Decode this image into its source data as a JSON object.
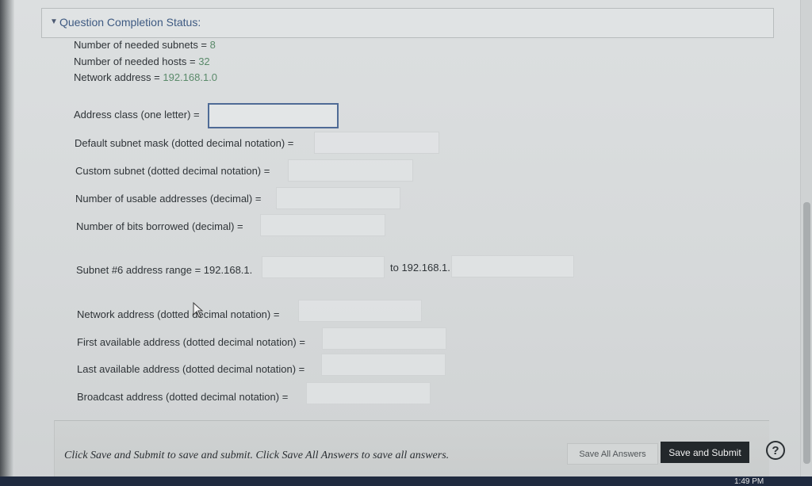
{
  "status": {
    "label": "Question Completion Status:"
  },
  "given": {
    "subnets": {
      "label": "Number of needed subnets = ",
      "value": "8"
    },
    "hosts": {
      "label": "Number of needed hosts = ",
      "value": "32"
    },
    "network": {
      "label": "Network address = ",
      "value": "192.168.1.0"
    }
  },
  "questions": {
    "address_class": {
      "label": "Address class (one letter) =",
      "value": ""
    },
    "default_mask": {
      "label": "Default subnet mask (dotted decimal notation) =",
      "value": ""
    },
    "custom_subnet": {
      "label": "Custom subnet (dotted decimal notation) =",
      "value": ""
    },
    "usable": {
      "label": "Number of usable addresses (decimal) =",
      "value": ""
    },
    "bits_borrowed": {
      "label": "Number of bits borrowed (decimal) =",
      "value": ""
    },
    "subnet6_range": {
      "label": "Subnet #6 address range = 192.168.1.",
      "to_label": "to 192.168.1.",
      "start": "",
      "end": ""
    },
    "net_address": {
      "label": "Network address (dotted decimal notation) =",
      "value": ""
    },
    "first_available": {
      "label": "First available address (dotted decimal notation) =",
      "value": ""
    },
    "last_available": {
      "label": "Last available address (dotted decimal notation) =",
      "value": ""
    },
    "broadcast": {
      "label": "Broadcast address (dotted decimal notation) =",
      "value": ""
    }
  },
  "footer": {
    "instructions": "Click Save and Submit to save and submit. Click Save All Answers to save all answers.",
    "save_all": "Save All Answers",
    "submit": "Save and Submit",
    "help": "?"
  },
  "taskbar": {
    "clock": "1:49 PM"
  },
  "icons": {
    "status_toggle": "chevron-down-icon",
    "help": "help-icon",
    "cursor": "mouse-pointer-icon"
  }
}
